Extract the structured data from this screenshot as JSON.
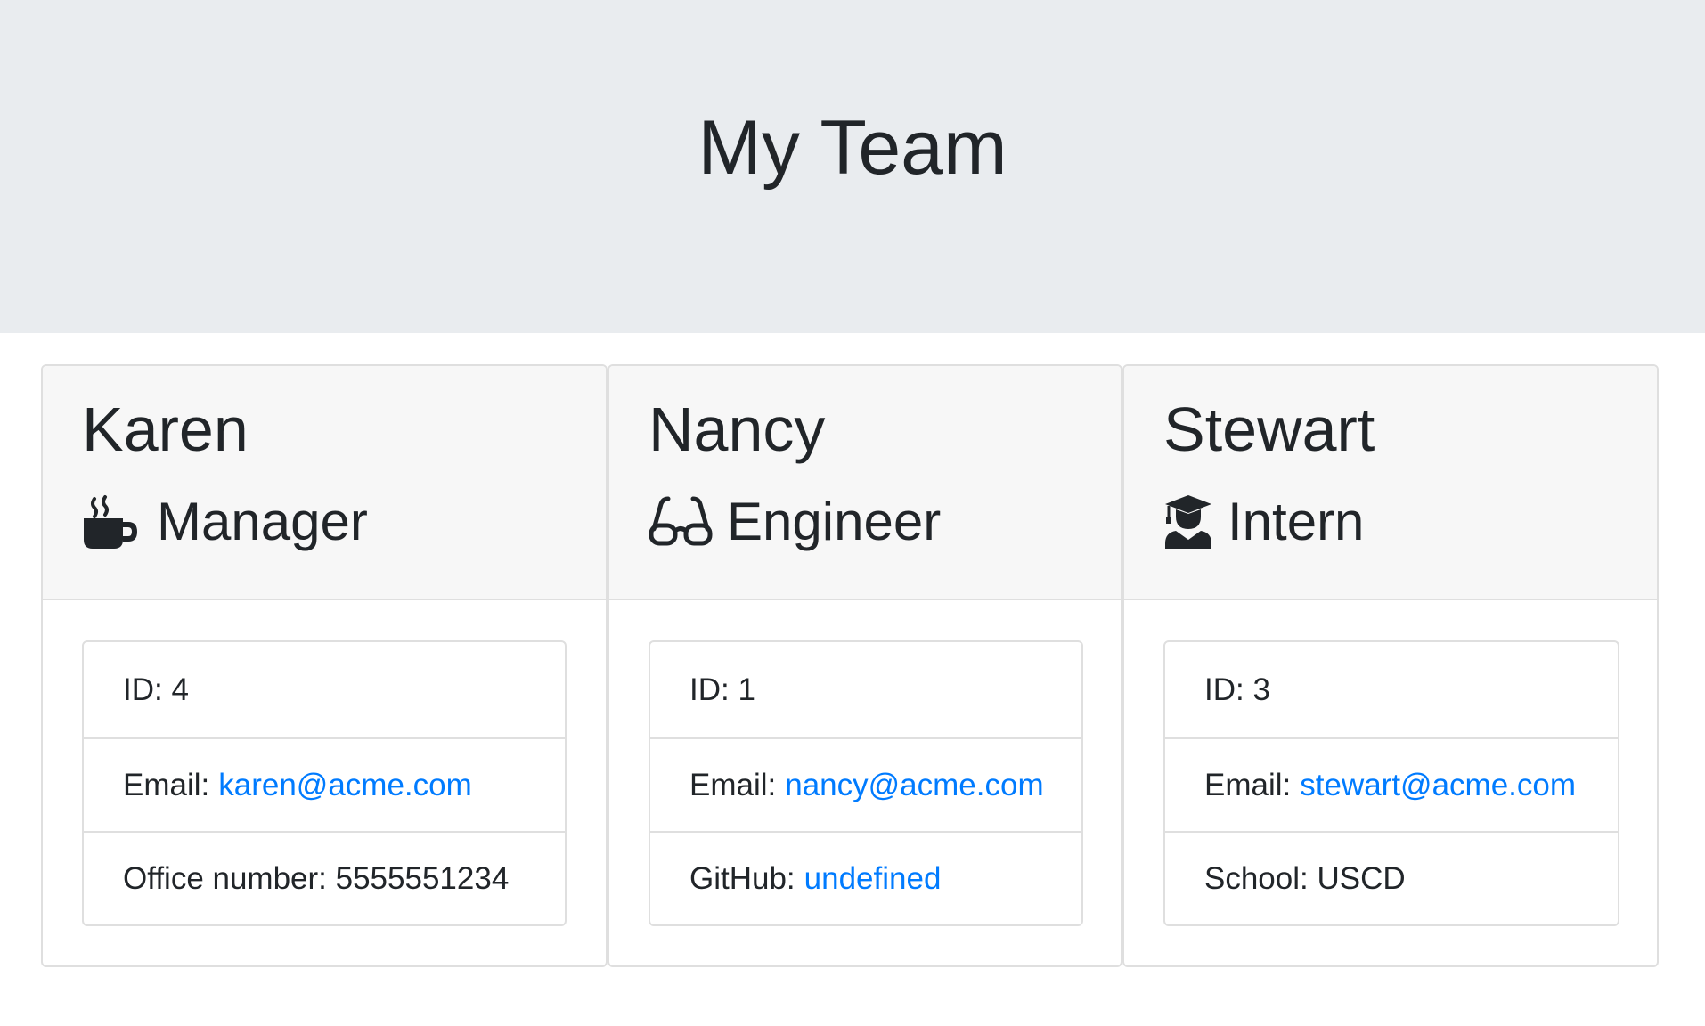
{
  "header": {
    "title": "My Team"
  },
  "colors": {
    "accent_link": "#007bff",
    "jumbotron_bg": "#e9ecef",
    "card_header_bg": "#f7f7f7"
  },
  "team": [
    {
      "name": "Karen",
      "role": "Manager",
      "icon": "mug-hot-icon",
      "id_text": "ID: 4",
      "email_label": "Email:",
      "email": "karen@acme.com",
      "extra_label": "Office number: 5555551234",
      "extra_link": ""
    },
    {
      "name": "Nancy",
      "role": "Engineer",
      "icon": "glasses-icon",
      "id_text": "ID: 1",
      "email_label": "Email:",
      "email": "nancy@acme.com",
      "extra_label": "GitHub:",
      "extra_link": "undefined"
    },
    {
      "name": "Stewart",
      "role": "Intern",
      "icon": "graduate-icon",
      "id_text": "ID: 3",
      "email_label": "Email:",
      "email": "stewart@acme.com",
      "extra_label": "School: USCD",
      "extra_link": ""
    }
  ]
}
